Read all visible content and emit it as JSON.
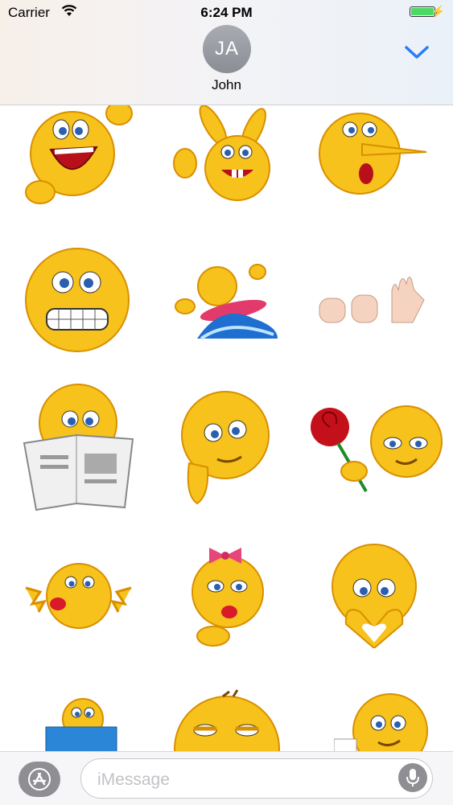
{
  "status_bar": {
    "carrier": "Carrier",
    "time": "6:24 PM",
    "battery_level": 1.0
  },
  "header": {
    "avatar_initials": "JA",
    "contact_name": "John"
  },
  "colors": {
    "emoji_yellow": "#f6c21b",
    "emoji_outline": "#d98f00",
    "accent_blue": "#2b7cf6",
    "toolbar_gray": "#8e8e93"
  },
  "stickers": [
    {
      "name": "laughing-waving-emoji"
    },
    {
      "name": "bunny-ears-thumbs-up-emoji"
    },
    {
      "name": "long-nose-pinocchio-emoji"
    },
    {
      "name": "grimacing-emoji"
    },
    {
      "name": "surfing-emoji"
    },
    {
      "name": "rock-paper-scissors-hands"
    },
    {
      "name": "reading-newspaper-emoji"
    },
    {
      "name": "thinking-chin-emoji"
    },
    {
      "name": "rose-flirting-emoji"
    },
    {
      "name": "tongue-out-emoji"
    },
    {
      "name": "bow-kiss-emoji"
    },
    {
      "name": "heart-hands-emoji"
    },
    {
      "name": "box-peeking-emoji"
    },
    {
      "name": "sleepy-emoji"
    },
    {
      "name": "coffee-emoji"
    }
  ],
  "compose": {
    "placeholder": "iMessage"
  }
}
